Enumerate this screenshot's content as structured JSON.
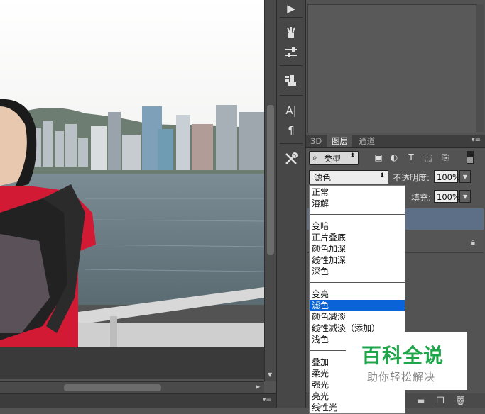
{
  "layers_panel": {
    "tabs": [
      {
        "label": "3D",
        "active": false
      },
      {
        "label": "图层",
        "active": true
      },
      {
        "label": "通道",
        "active": false
      }
    ],
    "filter": {
      "kind_label": "类型"
    },
    "blend": {
      "current": "滤色",
      "opacity_label": "不透明度:",
      "opacity_value": "100%",
      "fill_label": "填充:",
      "fill_value": "100%"
    },
    "blend_options": [
      [
        "正常",
        "溶解"
      ],
      [
        "变暗",
        "正片叠底",
        "颜色加深",
        "线性加深",
        "深色"
      ],
      [
        "变亮",
        "滤色",
        "颜色减淡",
        "线性减淡（添加）",
        "浅色"
      ],
      [
        "叠加",
        "柔光",
        "强光",
        "亮光",
        "线性光"
      ]
    ],
    "selected_option": "滤色"
  },
  "toolstrip": {
    "tools": [
      "play-icon",
      "brush-presets-icon",
      "sliders-icon",
      "clone-source-icon",
      "character-icon",
      "paragraph-icon",
      "tools-icon"
    ]
  },
  "watermark": {
    "title": "百科全说",
    "subtitle": "助你轻松解决"
  },
  "colors": {
    "selection": "#0a64d8",
    "panel_bg": "#535353",
    "watermark_green": "#1fa64a"
  }
}
